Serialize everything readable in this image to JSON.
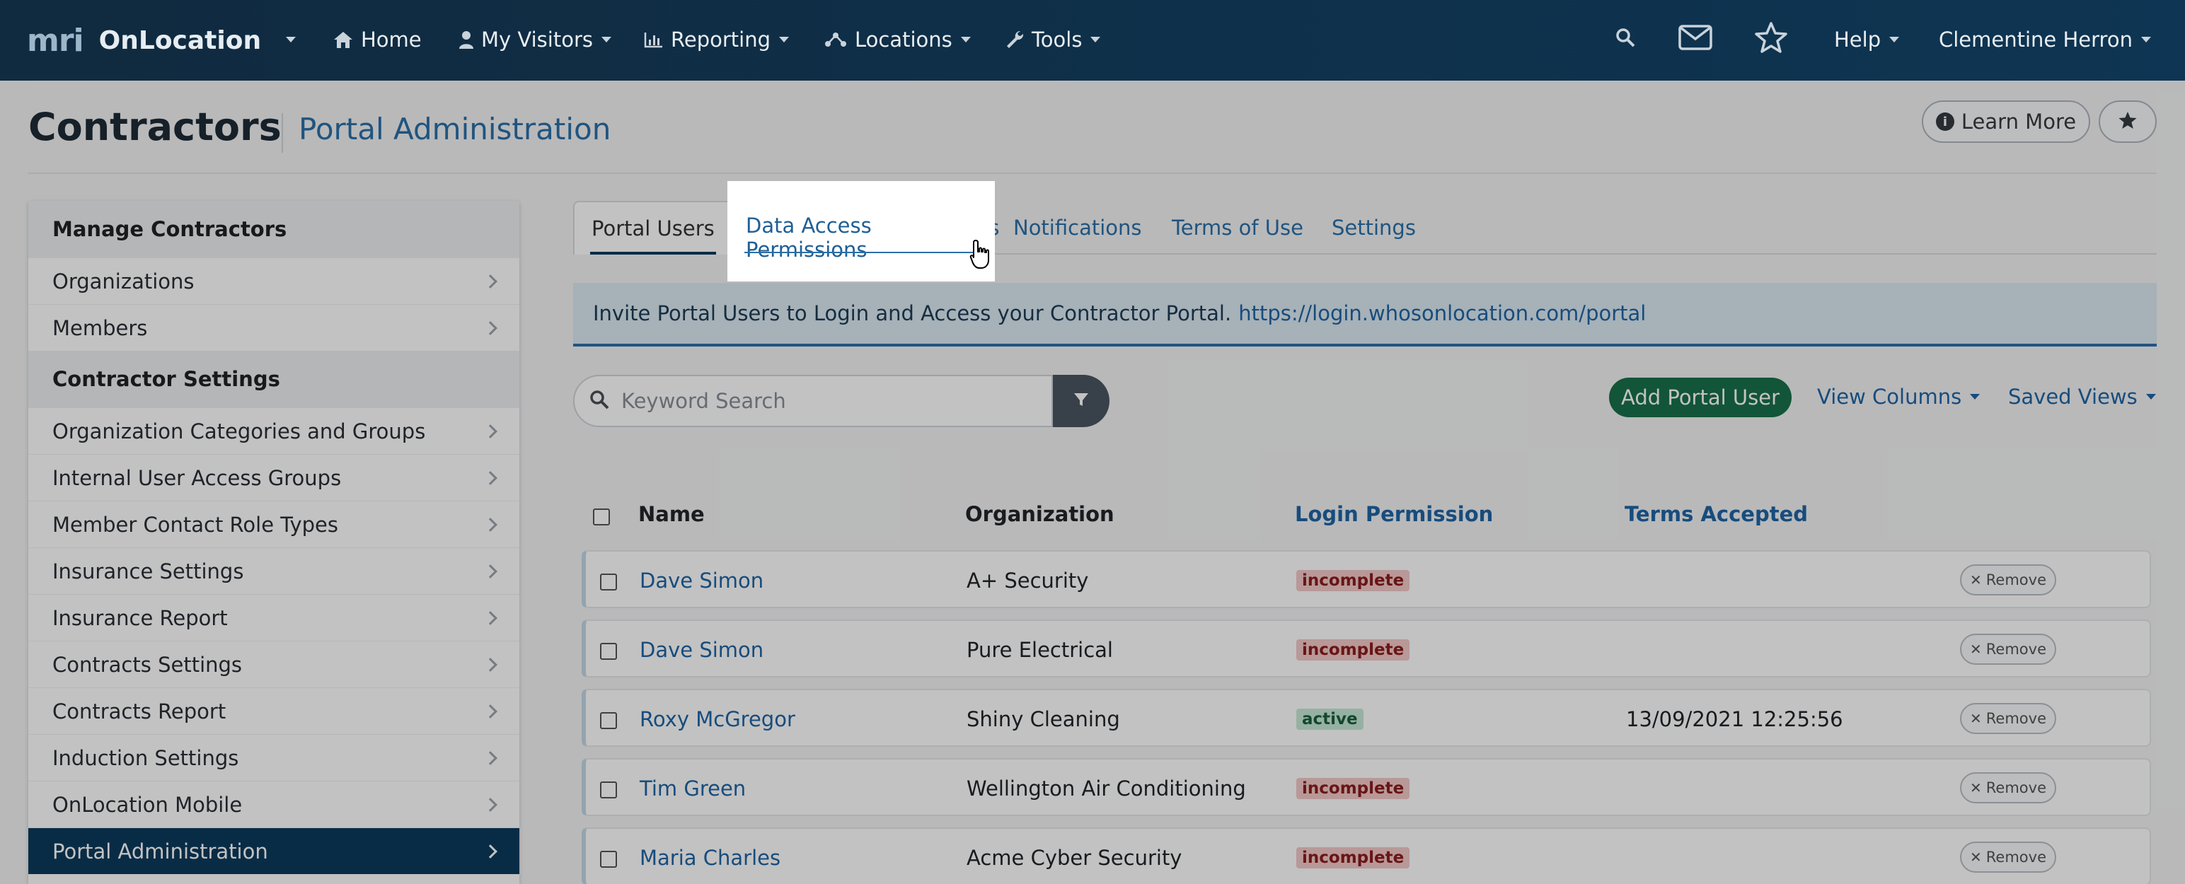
{
  "topnav": {
    "brand_mri": "mri",
    "brand_name": "OnLocation",
    "home": "Home",
    "my_visitors": "My Visitors",
    "reporting": "Reporting",
    "locations": "Locations",
    "tools": "Tools",
    "help": "Help",
    "user": "Clementine Herron"
  },
  "header": {
    "title": "Contractors",
    "subtitle": "Portal Administration",
    "learn_more": "Learn More"
  },
  "sidebar": {
    "section1": "Manage Contractors",
    "items1": [
      "Organizations",
      "Members"
    ],
    "section2": "Contractor Settings",
    "items2": [
      "Organization Categories and Groups",
      "Internal User Access Groups",
      "Member Contact Role Types",
      "Insurance Settings",
      "Insurance Report",
      "Contracts Settings",
      "Contracts Report",
      "Induction Settings",
      "OnLocation Mobile",
      "Portal Administration"
    ],
    "active_item": "Portal Administration"
  },
  "tabs": [
    "Portal Users",
    "Data Access Permissions",
    "Notifications",
    "Terms of Use",
    "Settings"
  ],
  "banner": {
    "text": "Invite Portal Users to Login and Access your Contractor Portal.",
    "link": "https://login.whosonlocation.com/portal"
  },
  "toolbar": {
    "search_placeholder": "Keyword Search",
    "add_label": "Add Portal User",
    "view_columns": "View Columns",
    "saved_views": "Saved Views"
  },
  "table": {
    "headers": [
      "Name",
      "Organization",
      "Login Permission",
      "Terms Accepted"
    ],
    "rows": [
      {
        "name": "Dave Simon",
        "org": "A+ Security",
        "status": "incomplete",
        "terms": ""
      },
      {
        "name": "Dave Simon",
        "org": "Pure Electrical",
        "status": "incomplete",
        "terms": ""
      },
      {
        "name": "Roxy McGregor",
        "org": "Shiny Cleaning",
        "status": "active",
        "terms": "13/09/2021 12:25:56"
      },
      {
        "name": "Tim Green",
        "org": "Wellington Air Conditioning",
        "status": "incomplete",
        "terms": ""
      },
      {
        "name": "Maria Charles",
        "org": "Acme Cyber Security",
        "status": "incomplete",
        "terms": ""
      }
    ],
    "remove_label": "Remove"
  },
  "colors": {
    "nav_bg": "#0e3553",
    "accent": "#1f64a5",
    "add_green": "#18704a",
    "sidebar_active": "#0d3a5c"
  }
}
